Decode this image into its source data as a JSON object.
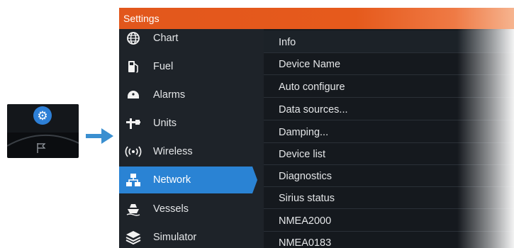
{
  "window": {
    "title": "Settings"
  },
  "sidebar": {
    "items": [
      {
        "label": "Chart",
        "icon": "globe-icon"
      },
      {
        "label": "Fuel",
        "icon": "fuel-pump-icon"
      },
      {
        "label": "Alarms",
        "icon": "alarm-icon"
      },
      {
        "label": "Units",
        "icon": "units-icon"
      },
      {
        "label": "Wireless",
        "icon": "wireless-icon"
      },
      {
        "label": "Network",
        "icon": "network-icon",
        "active": true
      },
      {
        "label": "Vessels",
        "icon": "vessel-icon"
      },
      {
        "label": "Simulator",
        "icon": "simulator-icon"
      }
    ]
  },
  "content": {
    "items": [
      {
        "label": "Info"
      },
      {
        "label": "Device Name"
      },
      {
        "label": "Auto configure"
      },
      {
        "label": "Data sources..."
      },
      {
        "label": "Damping..."
      },
      {
        "label": "Device list"
      },
      {
        "label": "Diagnostics"
      },
      {
        "label": "Sirius status"
      },
      {
        "label": "NMEA2000"
      },
      {
        "label": "NMEA0183"
      }
    ]
  },
  "colors": {
    "titlebar": "#e2571c",
    "active_item": "#2a83d4",
    "arrow": "#3a8fd0",
    "gear_button": "#2d7fd6"
  }
}
